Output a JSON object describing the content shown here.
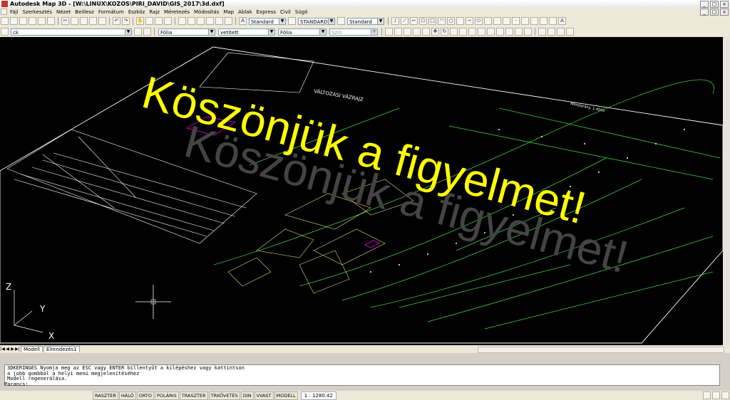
{
  "window": {
    "title": "Autodesk Map 3D - [W:\\LINUX\\KOZOS\\PIRI_DAVID\\GIS_2017\\3d.dxf]"
  },
  "menu": [
    "Fájl",
    "Szerkesztés",
    "Nézet",
    "Beillesz",
    "Formátum",
    "Eszköz",
    "Rajz",
    "Méretezés",
    "Módosítás",
    "Map",
    "Ablak",
    "Express",
    "Civil",
    "Súgó"
  ],
  "toolbar1": {
    "text_style": "Standard",
    "dim_style": "STANDARD",
    "table_style": "Standard"
  },
  "toolbar2": {
    "layer": "ck",
    "color": "Fólia",
    "linetype": "vetített",
    "lineweight": "Fólia",
    "plotstyle": "Szín"
  },
  "drawing": {
    "overlay_text": "Köszönjük a figyelmet!",
    "sheet_title": "VÁLTOZÁSI VÁZRAJZ",
    "scale_label": "Méretarány: 1:4000",
    "ucs": {
      "z": "Z",
      "y": "Y",
      "x": "X"
    }
  },
  "tabs": [
    "Modell",
    "Elrendezés1"
  ],
  "command": {
    "lines": [
      "3DKERINGÉS Nyomja meg az ESC vagy ENTER billentyűt a kilépéshez vagy kattintson",
      "a jobb gombbal a helyi menü megjelenítéséhez",
      "Modell regenerálása."
    ],
    "prompt": "Parancs:"
  },
  "status": {
    "buttons": [
      "RASZTER",
      "HÁLÓ",
      "ORTO",
      "POLÁRIS",
      "TRASZTER",
      "TRKÖVETÉS",
      "DIN",
      "VVAST",
      "MODELL"
    ],
    "scale": "1 : 1280.42"
  },
  "colors": {
    "canvas": "#000000",
    "overlay": "#ffff00",
    "line_green": "#3ccf3c",
    "line_white": "#ffffff",
    "line_magenta": "#c000c0"
  }
}
